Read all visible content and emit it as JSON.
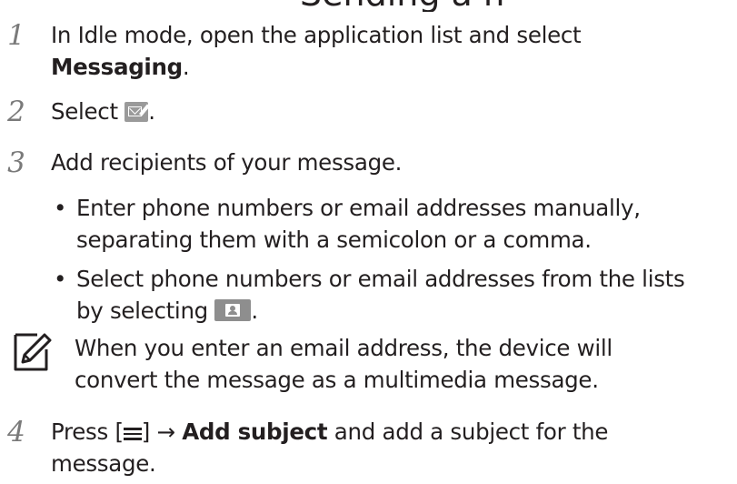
{
  "heading_partial": "Sending a message",
  "steps": [
    {
      "number": "1",
      "line1": "In Idle mode, open the application list and select",
      "line2_bold": "Messaging",
      "line2_end": "."
    },
    {
      "number": "2",
      "before": "Select",
      "icon": "compose-message-icon",
      "after": "."
    },
    {
      "number": "3",
      "text": "Add recipients of your message."
    },
    {
      "number": "4",
      "line1_before": "Press [",
      "line1_key": "menu-key-icon",
      "line1_after": "] →",
      "line1_bold": "Add subject",
      "line1_end": "and add a subject for the",
      "line2": "message."
    }
  ],
  "bullets": [
    {
      "marker": "•",
      "line1": "Enter phone numbers or email addresses manually,",
      "line2": "separating them with a semicolon or a comma."
    },
    {
      "marker": "•",
      "line1": "Select phone numbers or email addresses from the lists",
      "line2_before": "by selecting",
      "icon": "contacts-icon",
      "line2_after": "."
    }
  ],
  "note": {
    "icon": "note-pencil-icon",
    "line1": "When you enter an email address, the device will",
    "line2": "convert the message as a multimedia message."
  }
}
